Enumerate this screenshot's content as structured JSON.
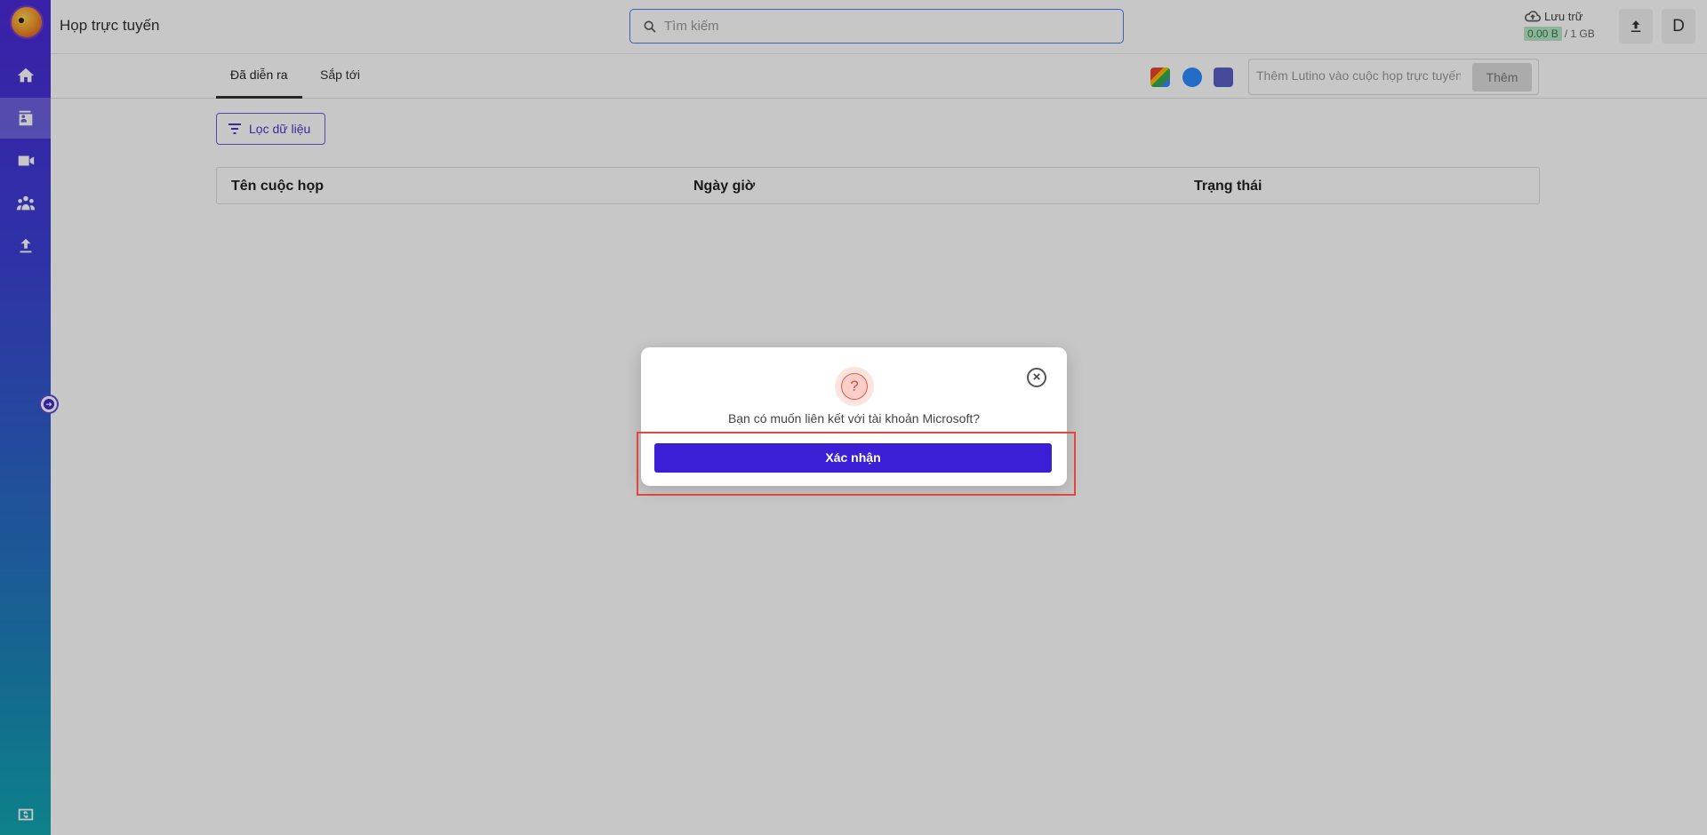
{
  "header": {
    "title": "Họp trực tuyến",
    "search_placeholder": "Tìm kiếm",
    "storage_label": "Lưu trữ",
    "storage_used": "0.00 B",
    "storage_total": "/ 1 GB",
    "avatar_letter": "D"
  },
  "tabs": [
    {
      "label": "Đã diễn ra",
      "active": true
    },
    {
      "label": "Sắp tới",
      "active": false
    }
  ],
  "integrations": {
    "add_placeholder": "Thêm Lutino vào cuộc họp trực tuyến",
    "add_button": "Thêm"
  },
  "filter": {
    "label": "Lọc dữ liệu"
  },
  "table": {
    "headers": [
      "Tên cuộc họp",
      "Ngày giờ",
      "Trạng thái"
    ]
  },
  "dialog": {
    "message": "Bạn có muốn liên kết với tài khoản Microsoft?",
    "confirm_label": "Xác nhận",
    "icon": "?",
    "close_icon": "×"
  },
  "sidebar": {
    "items": [
      "home-icon",
      "meeting-room-icon",
      "video-icon",
      "people-icon",
      "upload-icon",
      "billing-icon"
    ],
    "active_index": 1
  },
  "colors": {
    "accent": "#3b1fd6",
    "highlight": "#e0473f"
  }
}
